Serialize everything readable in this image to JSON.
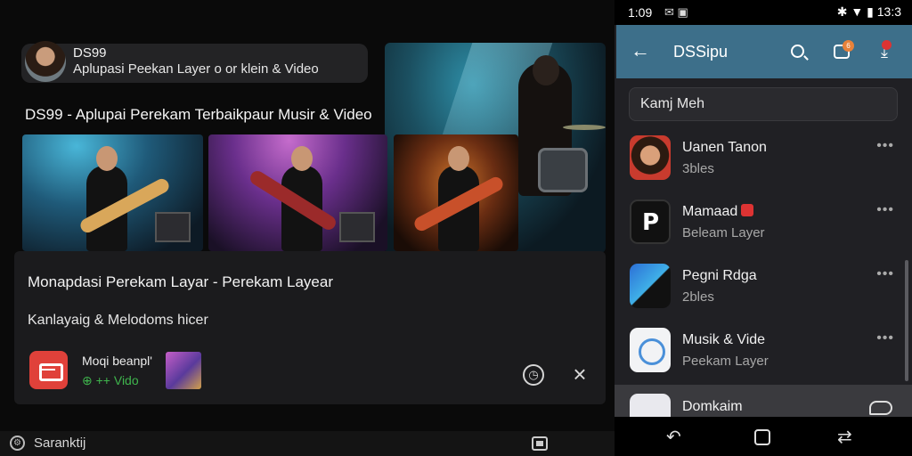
{
  "left": {
    "channel": {
      "name": "DS99",
      "subtitle": "Aplupasi Peekan Layer o or klein & Video"
    },
    "headline": "DS99 - Aplupai Perekam Terbaikpaur Musir & Video",
    "card": {
      "title": "Monapdasi Perekam Layar - Perekam Layear",
      "subtitle": "Kanlayaig & Melodoms hicer",
      "app_name": "Moqi beanpl'",
      "app_rating": "⊕ ++ Vido"
    },
    "bottom_bar": {
      "label": "Saranktij"
    }
  },
  "phone": {
    "status": {
      "time": "1:09",
      "icons_left": "✉ ▣",
      "right": "✱ ▼ ▮ 13:3"
    },
    "appbar": {
      "title": "DSSipu",
      "badge_count": "6"
    },
    "search_value": "Kamj Meh",
    "list": [
      {
        "title": "Uanen Tanon",
        "subtitle": "3bles"
      },
      {
        "title": "Mamaad",
        "subtitle": "Beleam Layer"
      },
      {
        "title": "Pegni Rdga",
        "subtitle": "2bles"
      },
      {
        "title": "Musik & Vide",
        "subtitle": "Peekam Layer"
      }
    ],
    "last_row": {
      "title": "Domkaim"
    },
    "more_label": "•••"
  },
  "colors": {
    "appbar": "#3d6f8a",
    "accent_red": "#e0413a",
    "rating_green": "#3fb54d"
  }
}
